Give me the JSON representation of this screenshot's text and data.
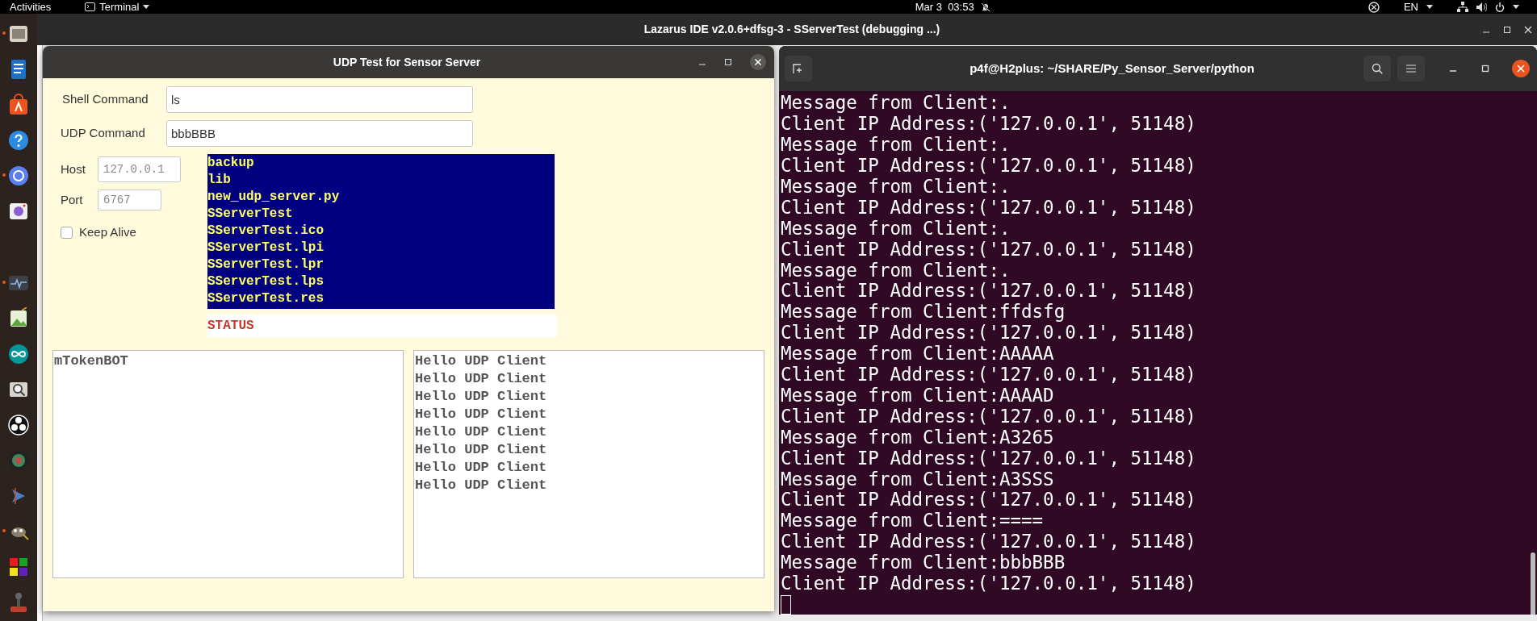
{
  "top_bar": {
    "activities": "Activities",
    "app_menu": "Terminal",
    "clock": "Mar 3  03:53",
    "input_language": "EN"
  },
  "ide_window": {
    "title": "Lazarus IDE v2.0.6+dfsg-3 - SServerTest (debugging ...)"
  },
  "dock": {
    "items": [
      {
        "running": true
      },
      {
        "running": false
      },
      {
        "running": false
      },
      {
        "running": false
      },
      {
        "running": true
      },
      {
        "running": false
      },
      {
        "running": true
      },
      {
        "running": false
      },
      {
        "running": false
      },
      {
        "running": false
      },
      {
        "running": false
      },
      {
        "running": false
      },
      {
        "running": false
      },
      {
        "running": true
      },
      {
        "running": false
      },
      {
        "running": false
      }
    ]
  },
  "udp_window": {
    "title": "UDP Test for Sensor Server",
    "shell_command": {
      "label": "Shell Command",
      "value": "ls"
    },
    "udp_command": {
      "label": "UDP Command",
      "value": "bbbBBB"
    },
    "host": {
      "label": "Host",
      "value": "127.0.0.1"
    },
    "port": {
      "label": "Port",
      "value": "6767"
    },
    "keep_alive": {
      "label": "Keep Alive",
      "checked": false
    },
    "file_list": [
      "backup",
      "lib",
      "new_udp_server.py",
      "SServerTest",
      "SServerTest.ico",
      "SServerTest.lpi",
      "SServerTest.lpr",
      "SServerTest.lps",
      "SServerTest.res"
    ],
    "status": "STATUS",
    "token_memo": [
      "mTokenBOT"
    ],
    "reply_memo": [
      "Hello UDP Client",
      "Hello UDP Client",
      "Hello UDP Client",
      "Hello UDP Client",
      "Hello UDP Client",
      "Hello UDP Client",
      "Hello UDP Client",
      "Hello UDP Client"
    ]
  },
  "terminal": {
    "title": "p4f@H2plus: ~/SHARE/Py_Sensor_Server/python",
    "lines": [
      "Message from Client:.",
      "Client IP Address:('127.0.0.1', 51148)",
      "Message from Client:.",
      "Client IP Address:('127.0.0.1', 51148)",
      "Message from Client:.",
      "Client IP Address:('127.0.0.1', 51148)",
      "Message from Client:.",
      "Client IP Address:('127.0.0.1', 51148)",
      "Message from Client:.",
      "Client IP Address:('127.0.0.1', 51148)",
      "Message from Client:ffdsfg",
      "Client IP Address:('127.0.0.1', 51148)",
      "Message from Client:AAAAA",
      "Client IP Address:('127.0.0.1', 51148)",
      "Message from Client:AAAAD",
      "Client IP Address:('127.0.0.1', 51148)",
      "Message from Client:A3265",
      "Client IP Address:('127.0.0.1', 51148)",
      "Message from Client:A3SSS",
      "Client IP Address:('127.0.0.1', 51148)",
      "Message from Client:====",
      "Client IP Address:('127.0.0.1', 51148)",
      "Message from Client:bbbBBB",
      "Client IP Address:('127.0.0.1', 51148)"
    ]
  }
}
